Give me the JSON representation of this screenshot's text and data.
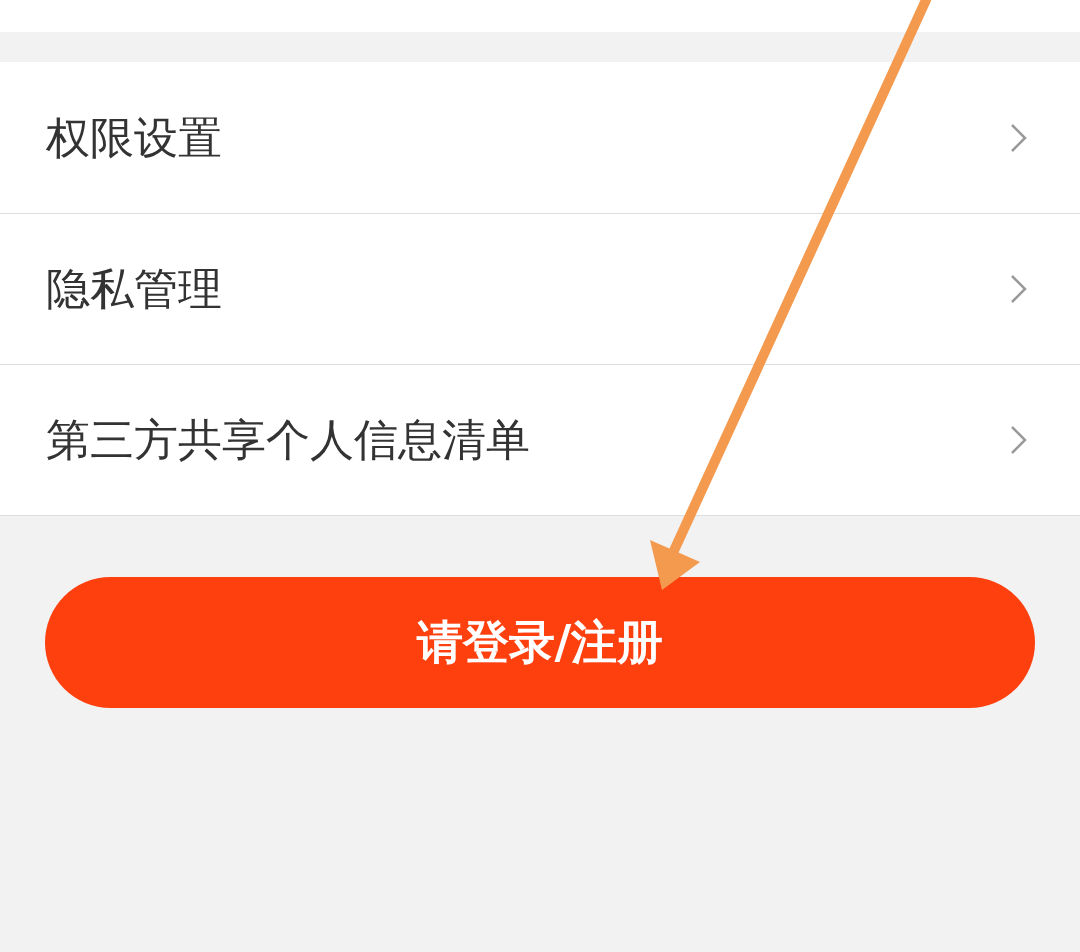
{
  "menu_items": [
    {
      "label": "权限设置"
    },
    {
      "label": "隐私管理"
    },
    {
      "label": "第三方共享个人信息清单"
    }
  ],
  "login_button": {
    "label": "请登录/注册"
  }
}
